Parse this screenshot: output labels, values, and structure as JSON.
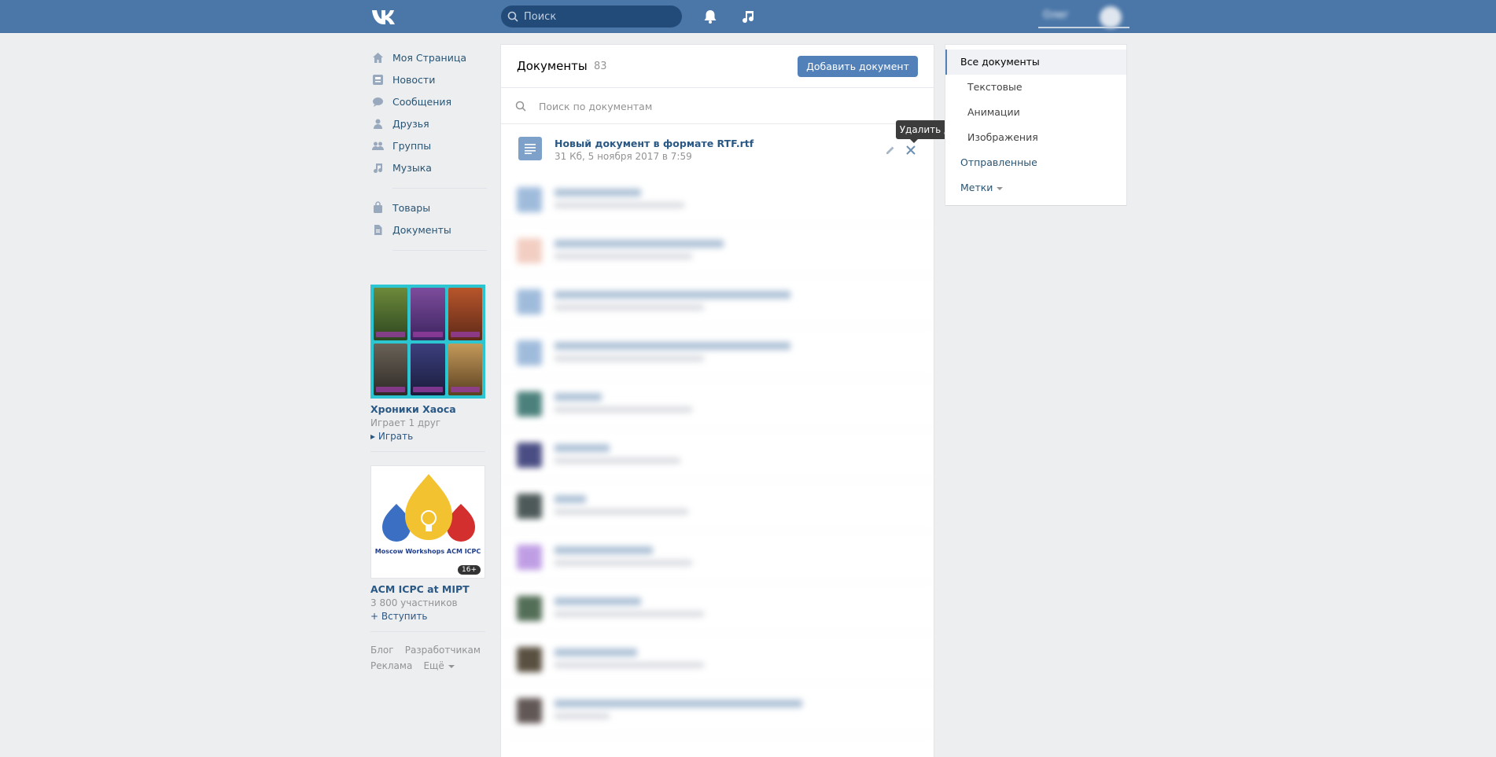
{
  "header": {
    "search_placeholder": "Поиск",
    "user_name": "Олег"
  },
  "left_nav": {
    "items": [
      {
        "label": "Моя Страница",
        "icon": "home-icon"
      },
      {
        "label": "Новости",
        "icon": "news-icon"
      },
      {
        "label": "Сообщения",
        "icon": "messages-icon"
      },
      {
        "label": "Друзья",
        "icon": "friends-icon"
      },
      {
        "label": "Группы",
        "icon": "groups-icon"
      },
      {
        "label": "Музыка",
        "icon": "music-icon"
      },
      {
        "label": "Товары",
        "icon": "goods-icon"
      },
      {
        "label": "Документы",
        "icon": "documents-icon"
      }
    ]
  },
  "game": {
    "title": "Хроники Хаоса",
    "subtitle": "Играет 1 друг",
    "action": "Играть"
  },
  "group": {
    "caption": "Moscow Workshops ACM ICPC",
    "age": "16+",
    "title": "ACM ICPC at MIPT",
    "members": "3 800 участников",
    "action": "Вступить"
  },
  "footer": {
    "links": [
      "Блог",
      "Разработчикам",
      "Реклама",
      "Ещё"
    ]
  },
  "main": {
    "title": "Документы",
    "count": "83",
    "add_button": "Добавить документ",
    "search_placeholder": "Поиск по документам",
    "first_doc": {
      "name": "Новый документ в формате RTF.rtf",
      "meta": "31 Кб, 5 ноября 2017 в 7:59"
    },
    "tooltip": "Удалить документ"
  },
  "right_menu": {
    "all": "Все документы",
    "text": "Текстовые",
    "animations": "Анимации",
    "images": "Изображения",
    "sent": "Отправленные",
    "tags": "Метки"
  },
  "colors": {
    "header_bg": "#4a76a8",
    "accent": "#5181b8",
    "link": "#2a5885"
  }
}
